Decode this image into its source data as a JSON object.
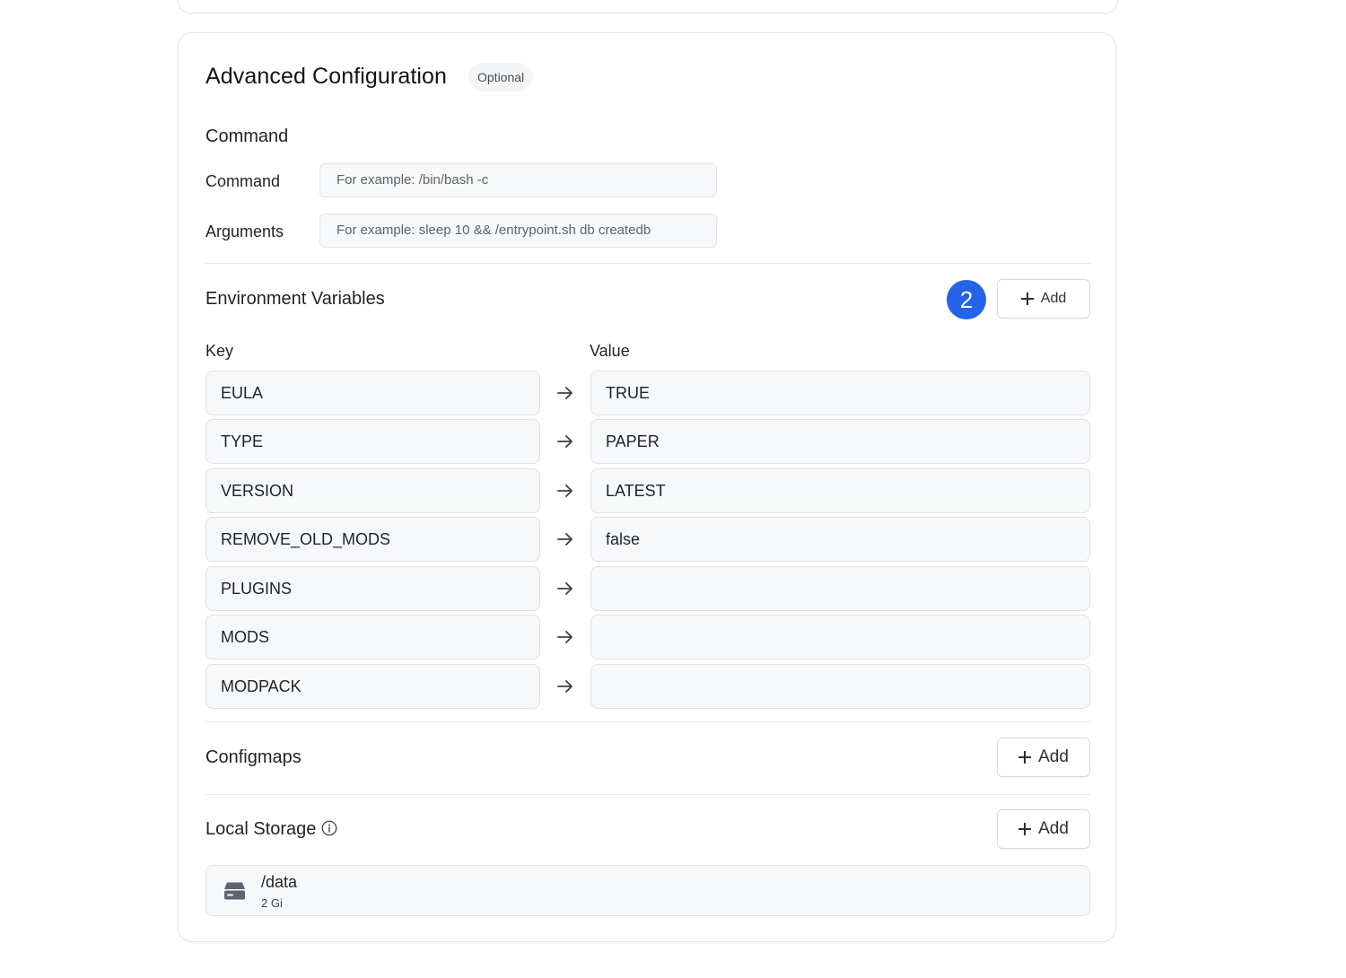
{
  "card": {
    "title": "Advanced Configuration",
    "badge": "Optional"
  },
  "command_section": {
    "title": "Command",
    "command_label": "Command",
    "command_placeholder": "For example:  /bin/bash -c",
    "arguments_label": "Arguments",
    "arguments_placeholder": "For example:  sleep 10 && /entrypoint.sh db createdb"
  },
  "env_section": {
    "title": "Environment Variables",
    "count": "2",
    "add_label": "Add",
    "key_header": "Key",
    "value_header": "Value",
    "rows": [
      {
        "key": "EULA",
        "value": "TRUE"
      },
      {
        "key": "TYPE",
        "value": "PAPER"
      },
      {
        "key": "VERSION",
        "value": "LATEST"
      },
      {
        "key": "REMOVE_OLD_MODS",
        "value": "false"
      },
      {
        "key": "PLUGINS",
        "value": ""
      },
      {
        "key": "MODS",
        "value": ""
      },
      {
        "key": "MODPACK",
        "value": ""
      }
    ]
  },
  "configmaps_section": {
    "title": "Configmaps",
    "add_label": "Add"
  },
  "storage_section": {
    "title": "Local Storage",
    "add_label": "Add",
    "items": [
      {
        "path": "/data",
        "size": "2 Gi"
      }
    ]
  },
  "colors": {
    "accent": "#2563eb",
    "border": "#e1e3e6",
    "input_bg": "#f7f8f9"
  },
  "icons": [
    "plus-icon",
    "arrow-right-icon",
    "info-icon",
    "drive-icon"
  ]
}
